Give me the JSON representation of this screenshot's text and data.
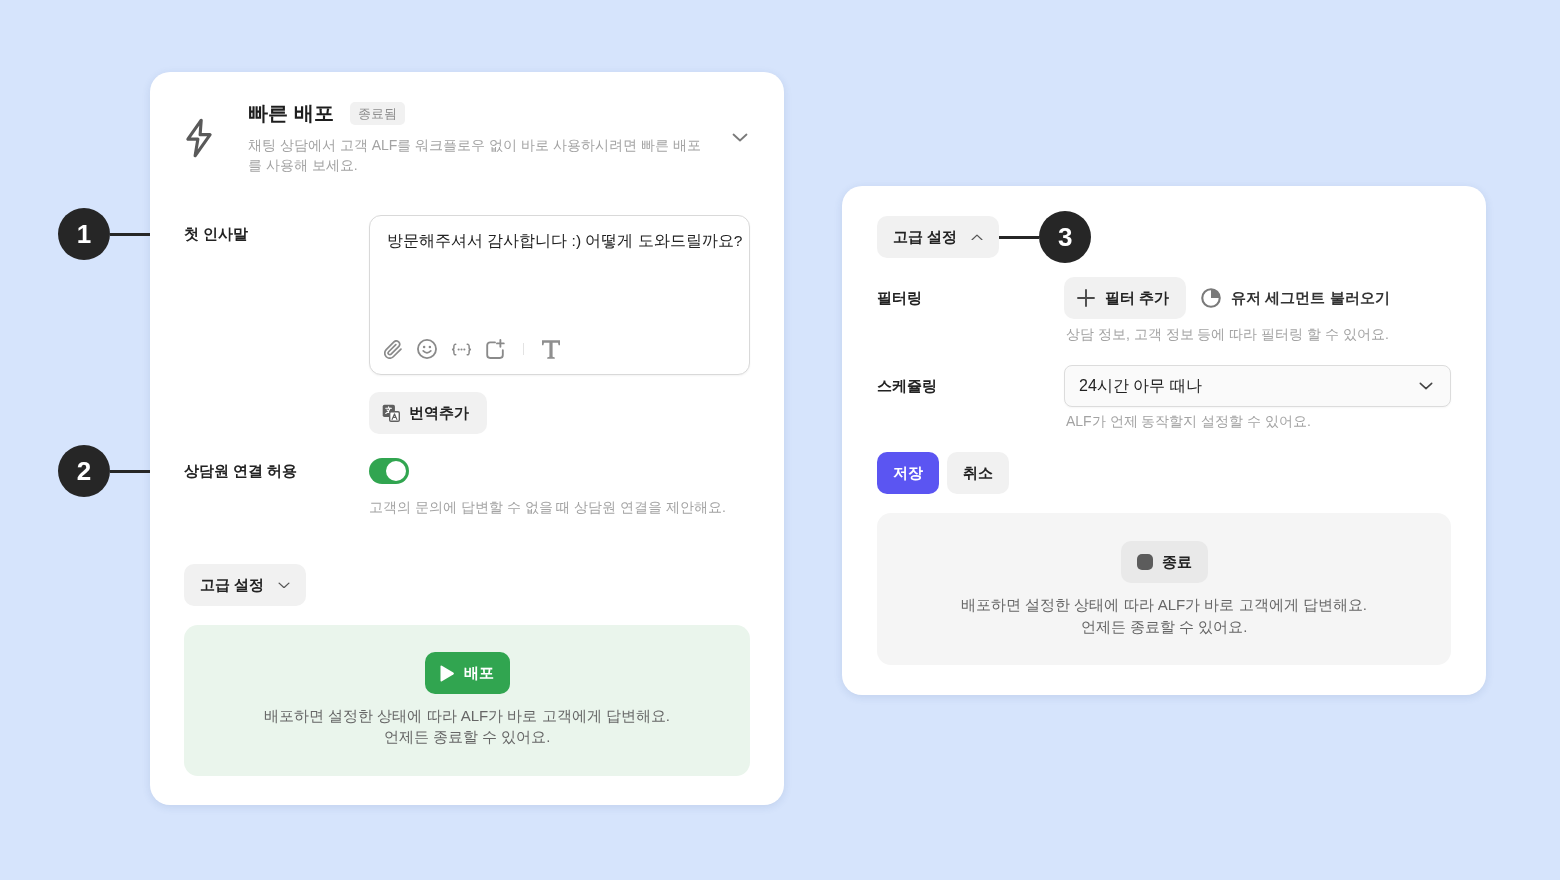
{
  "quick_deploy_panel": {
    "title": "빠른 배포",
    "status_badge": "종료됨",
    "description": "채팅 상담에서 고객 ALF를 워크플로우 없이 바로 사용하시려면 빠른 배포를 사용해 보세요.",
    "greeting": {
      "callout": "1",
      "label": "첫 인사말",
      "value": "방문해주셔서 감사합니다 :) 어떻게 도와드릴까요?",
      "add_translation_button": "번역추가"
    },
    "agent_handoff": {
      "callout": "2",
      "label": "상담원 연결 허용",
      "on": true,
      "hint": "고객의 문의에 답변할 수 없을 때 상담원 연결을 제안해요."
    },
    "advanced_settings_button": {
      "label": "고급 설정",
      "expanded": false
    },
    "deploy_box": {
      "kind": "deploy",
      "button": "배포",
      "message_lines": [
        "배포하면 설정한 상태에 따라 ALF가 바로 고객에게 답변해요.",
        "언제든 종료할 수 있어요."
      ]
    }
  },
  "advanced_settings_panel": {
    "toggle_button": {
      "callout": "3",
      "label": "고급 설정",
      "expanded": true
    },
    "filtering": {
      "label": "필터링",
      "add_filter_button": "필터 추가",
      "segment_button": "유저 세그먼트 불러오기",
      "hint": "상담 정보, 고객 정보 등에 따라 필터링 할 수 있어요."
    },
    "scheduling": {
      "label": "스케쥴링",
      "value": "24시간 아무 때나",
      "hint": "ALF가 언제 동작할지 설정할 수 있어요."
    },
    "actions": [
      {
        "label": "저장",
        "kind": "primary"
      },
      {
        "label": "취소",
        "kind": "secondary"
      }
    ],
    "deploy_box": {
      "kind": "stop",
      "button": "종료",
      "message_lines": [
        "배포하면 설정한 상태에 따라 ALF가 바로 고객에게 답변해요.",
        "언제든 종료할 수 있어요."
      ]
    }
  }
}
